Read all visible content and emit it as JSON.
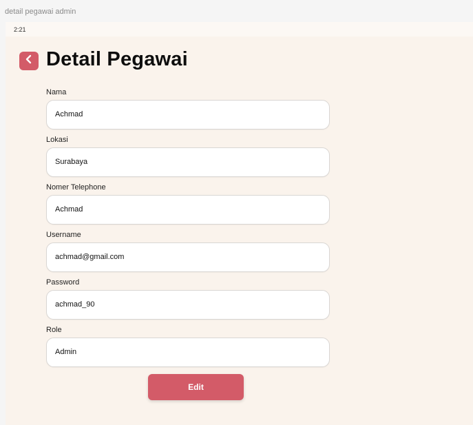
{
  "window": {
    "frame_label": "detail pegawai admin"
  },
  "statusbar": {
    "time": "2:21"
  },
  "header": {
    "title": "Detail Pegawai",
    "back_icon": "chevron-left-icon"
  },
  "form": {
    "fields": [
      {
        "label": "Nama",
        "value": "Achmad"
      },
      {
        "label": "Lokasi",
        "value": "Surabaya"
      },
      {
        "label": "Nomer Telephone",
        "value": "Achmad"
      },
      {
        "label": "Username",
        "value": "achmad@gmail.com"
      },
      {
        "label": "Password",
        "value": "achmad_90"
      },
      {
        "label": "Role",
        "value": "Admin"
      }
    ],
    "edit_label": "Edit"
  },
  "colors": {
    "accent": "#d35b68",
    "background": "#faf3ec",
    "field_border": "#d9d6d3"
  }
}
